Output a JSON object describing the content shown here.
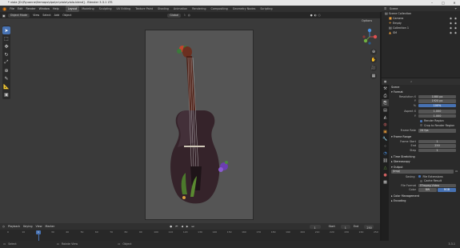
{
  "window": {
    "title": "* viola [D:\\Ryuanne\\Ilemaps\\dpa\\ec\\viola\\viola.blend] - Blender 3.3.1 LTS",
    "controls": [
      "–",
      "□",
      "✕"
    ]
  },
  "menu": [
    "File",
    "Edit",
    "Render",
    "Window",
    "Help"
  ],
  "workspaces": [
    "Layout",
    "Modeling",
    "Sculpting",
    "UV Editing",
    "Texture Paint",
    "Shading",
    "Animation",
    "Rendering",
    "Compositing",
    "Geometry Nodes",
    "Scripting"
  ],
  "active_workspace": "Layout",
  "topbar_right": {
    "scene_label": "Scene",
    "layer_label": "ViewLayer"
  },
  "viewport_header": {
    "mode": "Object Mode",
    "menus": [
      "View",
      "Select",
      "Add",
      "Object"
    ],
    "transform": "Global",
    "options": "Options"
  },
  "toolbar_icons": [
    "cursor-icon",
    "select-box-icon",
    "move-icon",
    "rotate-icon",
    "scale-icon",
    "transform-icon",
    "annotate-icon",
    "measure-icon",
    "add-cube-icon"
  ],
  "gizmo": {
    "x": "X",
    "y": "Y",
    "z": "Z"
  },
  "timeline": {
    "menus": [
      "Playback",
      "Keying",
      "View",
      "Marker"
    ],
    "current_frame": "1",
    "start_label": "Start",
    "start": "1",
    "end_label": "End",
    "end": "250",
    "ticks": [
      "0",
      "10",
      "20",
      "30",
      "40",
      "50",
      "60",
      "70",
      "80",
      "90",
      "100",
      "110",
      "120",
      "130",
      "140",
      "150",
      "160",
      "170",
      "180",
      "190",
      "200",
      "210",
      "220",
      "230",
      "240",
      "250"
    ]
  },
  "status": {
    "select": "Select",
    "rotate": "Rotate View",
    "object": "Object",
    "version": "3.3.1"
  },
  "outliner": {
    "title": "Scene Collection",
    "items": [
      {
        "name": "Camera",
        "icon": "camera-icon"
      },
      {
        "name": "Empty",
        "icon": "empty-icon"
      },
      {
        "name": "Collection 1",
        "icon": "collection-icon"
      },
      {
        "name": "SM",
        "icon": "mesh-icon"
      }
    ]
  },
  "properties": {
    "scene_label": "Scene",
    "format_title": "Format",
    "res_x_label": "Resolution X",
    "res_x": "1080 px",
    "res_y_label": "Y",
    "res_y": "1920 px",
    "res_pct_label": "%",
    "res_pct": "100%",
    "aspect_x_label": "Aspect X",
    "aspect_x": "1.000",
    "aspect_y_label": "Y",
    "aspect_y": "1.000",
    "render_region": "Render Region",
    "crop": "Crop to Render Region",
    "frame_rate_label": "Frame Rate",
    "frame_rate": "24 fps",
    "frame_range_title": "Frame Range",
    "frame_start_label": "Frame Start",
    "frame_start": "1",
    "frame_end_label": "End",
    "frame_end": "250",
    "step_label": "Step",
    "step": "1",
    "time_stretching": "Time Stretching",
    "stereoscopy": "Stereoscopy",
    "output_title": "Output",
    "output_path": "/tmp\\",
    "saving_label": "Saving",
    "file_extensions": "File Extensions",
    "cache_result": "Cache Result",
    "file_format_label": "File Format",
    "file_format": "FFmpeg Video",
    "color_label": "Color",
    "color_bw": "BW",
    "color_rgb": "RGB",
    "color_management": "Color Management",
    "encoding": "Encoding"
  },
  "colors": {
    "accent": "#4772b3",
    "viewport": "#3a3a3a",
    "camera": "#555555"
  }
}
